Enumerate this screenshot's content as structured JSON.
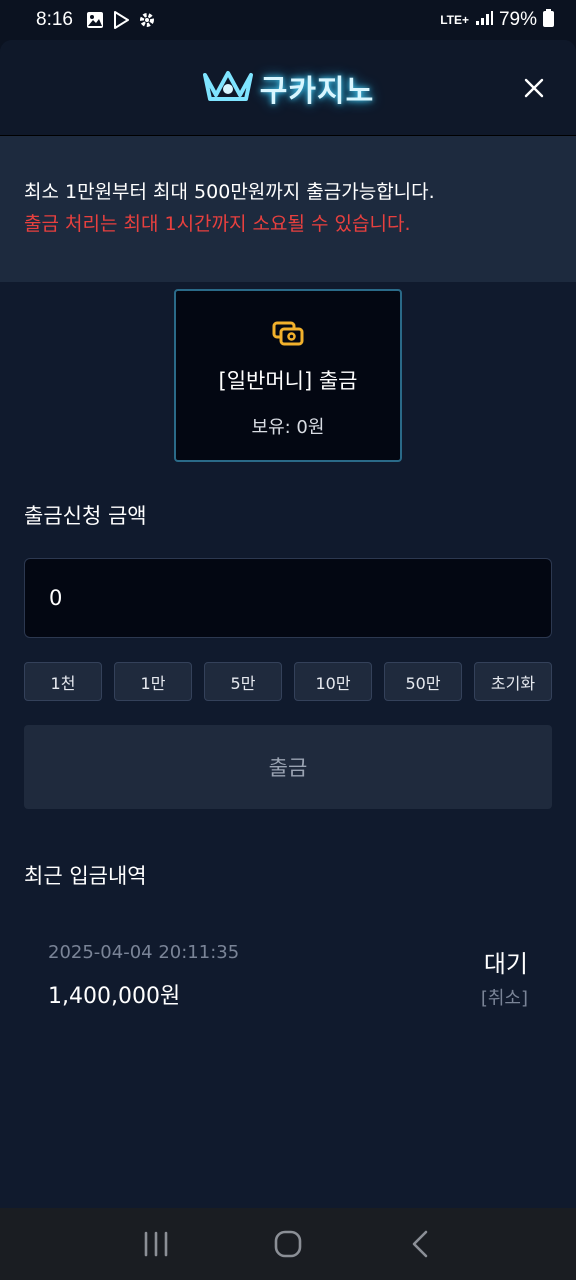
{
  "status_bar": {
    "time": "8:16",
    "network": "LTE+",
    "battery": "79%"
  },
  "header": {
    "logo_text": "구카지노",
    "close_icon": "close-icon"
  },
  "notice": {
    "line1": "최소 1만원부터 최대 500만원까지 출금가능합니다.",
    "line2": "출금 처리는 최대 1시간까지 소요될 수 있습니다."
  },
  "withdraw_type": {
    "icon": "wallet-icon",
    "title": "[일반머니] 출금",
    "balance": "보유: 0원"
  },
  "amount": {
    "label": "출금신청 금액",
    "value": "0"
  },
  "quick_buttons": [
    "1천",
    "1만",
    "5만",
    "10만",
    "50만",
    "초기화"
  ],
  "submit_label": "출금",
  "history": {
    "label": "최근 입금내역",
    "items": [
      {
        "date": "2025-04-04 20:11:35",
        "amount": "1,400,000원",
        "status": "대기",
        "cancel": "[취소]"
      }
    ]
  },
  "colors": {
    "background": "#101a2d",
    "notice_bg": "#1d2a3e",
    "warning": "#e8403e",
    "card_border": "#2a6a88",
    "wallet_icon": "#f2b12c"
  }
}
